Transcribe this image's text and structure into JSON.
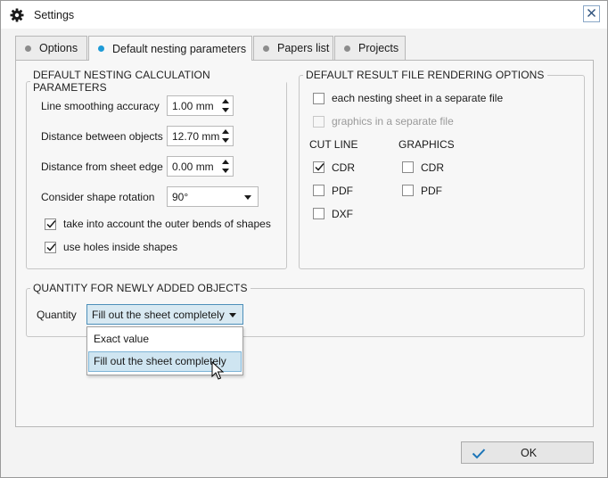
{
  "window": {
    "title": "Settings",
    "title_icon": "gear-icon",
    "close_icon": "close-icon"
  },
  "tabs": [
    {
      "label": "Options",
      "active": false
    },
    {
      "label": "Default nesting parameters",
      "active": true
    },
    {
      "label": "Papers list",
      "active": false
    },
    {
      "label": "Projects",
      "active": false
    }
  ],
  "calc_params": {
    "legend": "DEFAULT NESTING CALCULATION PARAMETERS",
    "line_smoothing": {
      "label": "Line smoothing accuracy",
      "value": "1.00 mm"
    },
    "distance_objects": {
      "label": "Distance between objects",
      "value": "12.70 mm"
    },
    "distance_edge": {
      "label": "Distance from sheet edge",
      "value": "0.00 mm"
    },
    "shape_rotation": {
      "label": "Consider shape rotation",
      "value": "90°"
    },
    "outer_bends": {
      "label": "take into account the outer bends of shapes",
      "checked": true
    },
    "holes_inside": {
      "label": "use holes inside shapes",
      "checked": true
    }
  },
  "rendering": {
    "legend": "DEFAULT RESULT FILE RENDERING OPTIONS",
    "separate_file": {
      "label": "each nesting sheet in a separate file",
      "checked": false
    },
    "graphics_separate": {
      "label": "graphics in a separate file",
      "checked": false,
      "disabled": true
    },
    "cut_line": {
      "header": "CUT LINE",
      "items": [
        {
          "label": "CDR",
          "checked": true
        },
        {
          "label": "PDF",
          "checked": false
        },
        {
          "label": "DXF",
          "checked": false
        }
      ]
    },
    "graphics": {
      "header": "GRAPHICS",
      "items": [
        {
          "label": "CDR",
          "checked": false
        },
        {
          "label": "PDF",
          "checked": false
        }
      ]
    }
  },
  "quantity": {
    "legend": "QUANTITY FOR NEWLY ADDED OBJECTS",
    "label": "Quantity",
    "value": "Fill out the sheet completely",
    "options": [
      "Exact value",
      "Fill out the sheet completely"
    ],
    "selected_index": 1
  },
  "footer": {
    "ok_label": "OK",
    "ok_icon": "checkmark-icon"
  },
  "colors": {
    "accent": "#1e9bd7",
    "selection": "#cfe5f1",
    "check_icon": "#1c75b8"
  }
}
